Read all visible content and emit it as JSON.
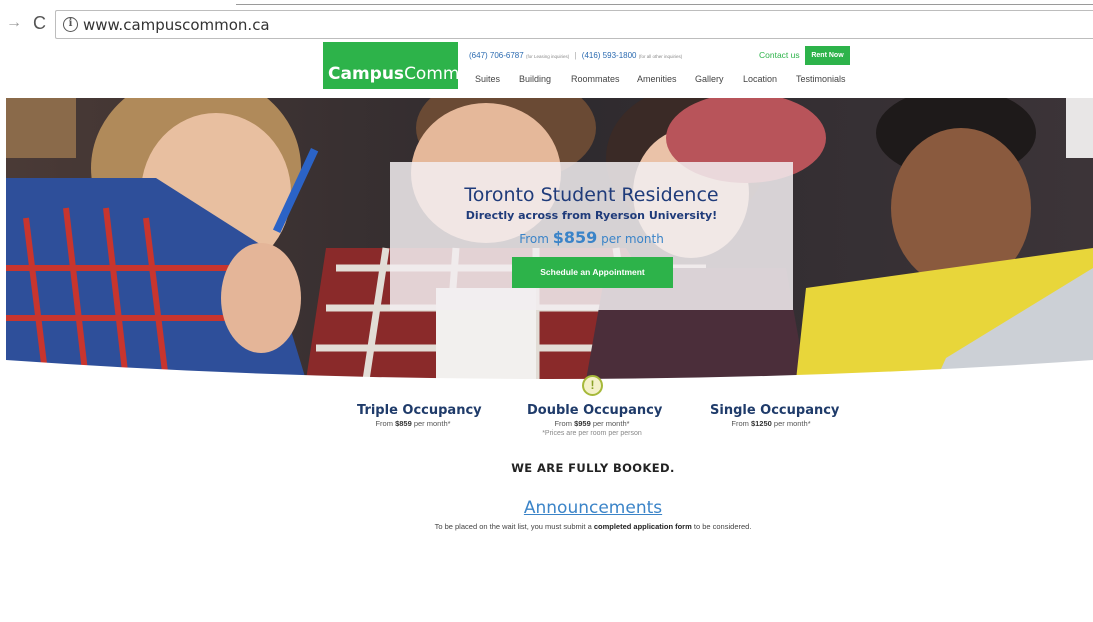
{
  "browser": {
    "forward_icon": "→",
    "reload_icon": "C",
    "info_icon": "i",
    "url": "www.campuscommon.ca"
  },
  "header": {
    "logo_bold": "Campus",
    "logo_regular": "Common",
    "phone1": "(647) 706-6787",
    "phone1_note": "(for Leasing inquiries)",
    "separator": "|",
    "phone2": "(416) 593-1800",
    "phone2_note": "(for all other inquiries)",
    "contact_label": "Contact us",
    "rent_label": "Rent Now",
    "nav": [
      "Suites",
      "Building",
      "Roommates",
      "Amenities",
      "Gallery",
      "Location",
      "Testimonials"
    ]
  },
  "hero": {
    "title": "Toronto Student Residence",
    "subtitle": "Directly across from Ryerson University!",
    "price_prefix": "From",
    "price": "$859",
    "price_suffix": "per month",
    "cta_label": "Schedule an Appointment"
  },
  "warning_icon_glyph": "!",
  "occupancy": [
    {
      "title": "Triple Occupancy",
      "price_prefix": "From",
      "price": "$859",
      "price_suffix": "per month*"
    },
    {
      "title": "Double Occupancy",
      "price_prefix": "From",
      "price": "$959",
      "price_suffix": "per month*",
      "note": "*Prices are per room per person"
    },
    {
      "title": "Single Occupancy",
      "price_prefix": "From",
      "price": "$1250",
      "price_suffix": "per month*"
    }
  ],
  "status": "WE ARE FULLY BOOKED.",
  "announcements": {
    "title": "Announcements",
    "text_before": "To be placed on the wait list, you must submit a",
    "text_bold": "completed application form",
    "text_after": "to be considered."
  },
  "colors": {
    "brand_green": "#2db34a",
    "title_blue": "#1f3b7a",
    "link_blue": "#3b84c8"
  }
}
